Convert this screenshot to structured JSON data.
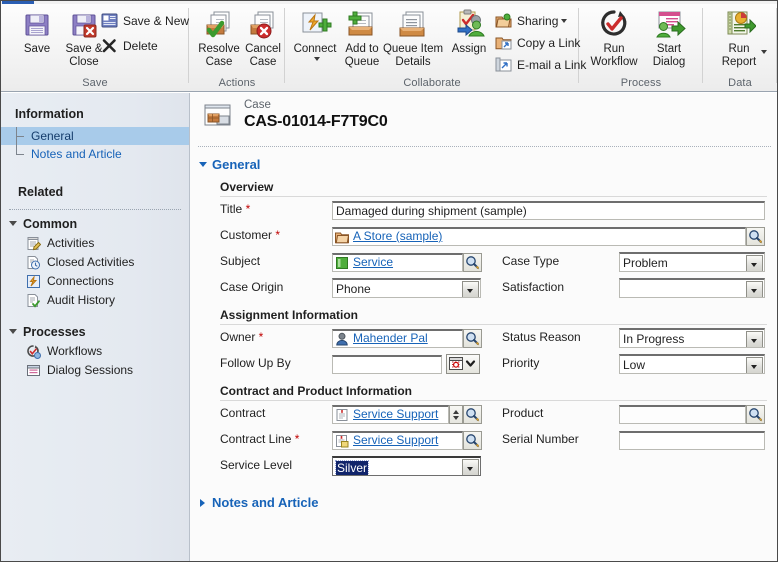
{
  "window": {
    "accent_color": "#2a5eb3"
  },
  "ribbon": {
    "groups": [
      {
        "label": "Save",
        "large_buttons": [
          {
            "label_line1": "Save",
            "label_line2": "",
            "icon": "save-floppy-icon"
          },
          {
            "label_line1": "Save &",
            "label_line2": "Close",
            "icon": "save-close-floppy-icon"
          }
        ],
        "small_buttons": [
          {
            "label": "Save & New",
            "icon": "save-new-icon"
          },
          {
            "label": "Delete",
            "icon": "delete-x-icon"
          }
        ]
      },
      {
        "label": "Actions",
        "large_buttons": [
          {
            "label_line1": "Resolve",
            "label_line2": "Case",
            "icon": "resolve-case-icon"
          },
          {
            "label_line1": "Cancel",
            "label_line2": "Case",
            "icon": "cancel-case-icon"
          }
        ],
        "small_buttons": []
      },
      {
        "label": "Collaborate",
        "large_buttons": [
          {
            "label_line1": "Connect",
            "label_line2": "",
            "icon": "connect-icon",
            "has_menu": true
          },
          {
            "label_line1": "Add to",
            "label_line2": "Queue",
            "icon": "add-to-queue-icon"
          },
          {
            "label_line1": "Queue Item",
            "label_line2": "Details",
            "icon": "queue-item-details-icon"
          },
          {
            "label_line1": "Assign",
            "label_line2": "",
            "icon": "assign-icon"
          }
        ],
        "small_buttons": [
          {
            "label": "Sharing",
            "icon": "sharing-icon",
            "has_menu": true
          },
          {
            "label": "Copy a Link",
            "icon": "copy-link-icon"
          },
          {
            "label": "E-mail a Link",
            "icon": "email-link-icon"
          }
        ]
      },
      {
        "label": "Process",
        "large_buttons": [
          {
            "label_line1": "Run",
            "label_line2": "Workflow",
            "icon": "run-workflow-icon"
          },
          {
            "label_line1": "Start",
            "label_line2": "Dialog",
            "icon": "start-dialog-icon"
          }
        ],
        "small_buttons": []
      },
      {
        "label": "Data",
        "large_buttons": [
          {
            "label_line1": "Run",
            "label_line2": "Report",
            "icon": "run-report-icon",
            "has_menu": true
          }
        ],
        "small_buttons": []
      }
    ]
  },
  "nav": {
    "information_heading": "Information",
    "information_items": [
      {
        "label": "General",
        "selected": true
      },
      {
        "label": "Notes and Article",
        "selected": false
      }
    ],
    "related_heading": "Related",
    "groups": [
      {
        "label": "Common",
        "items": [
          {
            "label": "Activities",
            "icon": "activities-icon"
          },
          {
            "label": "Closed Activities",
            "icon": "closed-activities-icon"
          },
          {
            "label": "Connections",
            "icon": "connections-icon"
          },
          {
            "label": "Audit History",
            "icon": "audit-history-icon"
          }
        ]
      },
      {
        "label": "Processes",
        "items": [
          {
            "label": "Workflows",
            "icon": "workflows-icon"
          },
          {
            "label": "Dialog Sessions",
            "icon": "dialog-sessions-icon"
          }
        ]
      }
    ]
  },
  "record": {
    "entity_type": "Case",
    "name": "CAS-01014-F7T9C0",
    "icon": "case-record-icon"
  },
  "form": {
    "general_section": "General",
    "notes_section": "Notes and Article",
    "subsections": {
      "overview": "Overview",
      "assignment": "Assignment Information",
      "contract": "Contract and Product Information"
    },
    "fields": {
      "title": {
        "label": "Title",
        "required": true,
        "value": "Damaged during shipment (sample)"
      },
      "customer": {
        "label": "Customer",
        "required": true,
        "value": "A Store (sample)",
        "icon": "account-icon"
      },
      "subject": {
        "label": "Subject",
        "required": false,
        "value": "Service",
        "icon": "subject-icon"
      },
      "case_type": {
        "label": "Case Type",
        "required": false,
        "value": "Problem"
      },
      "case_origin": {
        "label": "Case Origin",
        "required": false,
        "value": "Phone"
      },
      "satisfaction": {
        "label": "Satisfaction",
        "required": false,
        "value": ""
      },
      "owner": {
        "label": "Owner",
        "required": true,
        "value": "Mahender Pal",
        "icon": "user-icon"
      },
      "status_reason": {
        "label": "Status Reason",
        "required": false,
        "value": "In Progress"
      },
      "follow_up_by": {
        "label": "Follow Up By",
        "required": false,
        "value": ""
      },
      "priority": {
        "label": "Priority",
        "required": false,
        "value": "Low"
      },
      "contract": {
        "label": "Contract",
        "required": false,
        "value": "Service Support",
        "icon": "contract-icon"
      },
      "product": {
        "label": "Product",
        "required": false,
        "value": ""
      },
      "contract_line": {
        "label": "Contract Line",
        "required": true,
        "value": "Service Support",
        "icon": "contract-line-icon"
      },
      "serial_number": {
        "label": "Serial Number",
        "required": false,
        "value": ""
      },
      "service_level": {
        "label": "Service Level",
        "required": false,
        "value": "Silver"
      }
    }
  }
}
